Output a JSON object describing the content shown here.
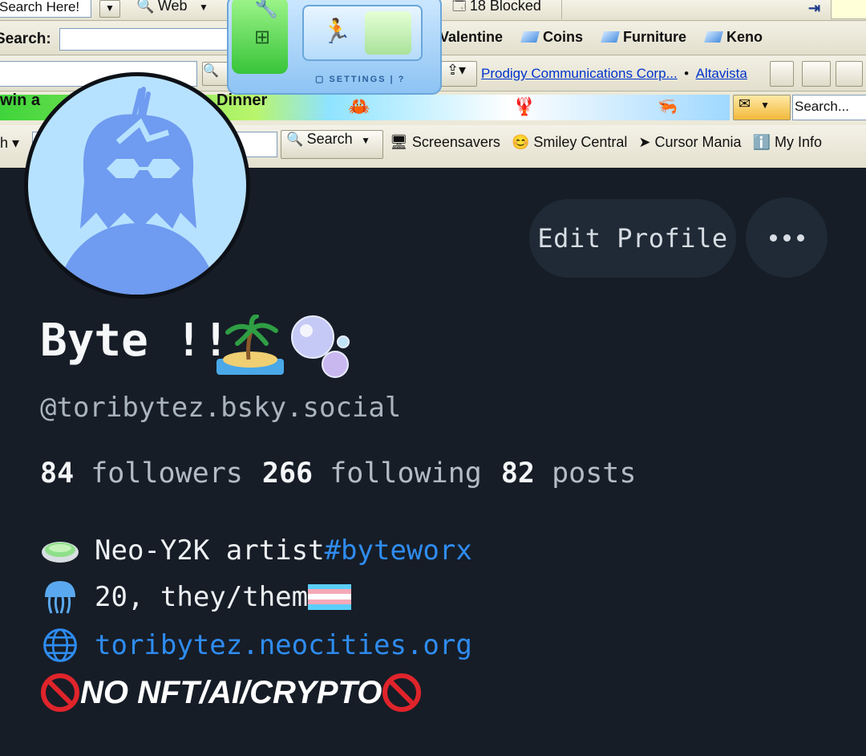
{
  "toolbar": {
    "search_here": "Search Here!",
    "web_label": "Web",
    "blocked_label": "18 Blocked",
    "search_label": "Search:",
    "links": [
      "Valentine",
      "Coins",
      "Furniture",
      "Keno"
    ],
    "settings_label": "SETTINGS",
    "settings_help": "?",
    "prodigy_link": "Prodigy Communications Corp...",
    "bullet": "•",
    "altavista_link": "Altavista",
    "ticker_left": "win a",
    "ticker_right": "Dinner",
    "mail_search_placeholder": "Search...",
    "search_button": "Search",
    "screensavers": "Screensavers",
    "smiley_central": "Smiley Central",
    "cursor_mania": "Cursor Mania",
    "my_info": "My Info",
    "small_left": "h"
  },
  "profile": {
    "display_name": "Byte !!",
    "handle": "@toribytez.bsky.social",
    "edit_button": "Edit Profile",
    "followers_count": "84",
    "followers_label": "followers",
    "following_count": "266",
    "following_label": "following",
    "posts_count": "82",
    "posts_label": "posts",
    "bio": {
      "line1_text": "Neo-Y2K artist ",
      "line1_tag": "#byteworx",
      "line2_text": "20, they/them",
      "line3_link": "toribytez.neocities.org",
      "line4_text": "NO NFT/AI/CRYPTO"
    }
  },
  "colors": {
    "background": "#161d27",
    "button_bg": "#1f2a36",
    "link": "#2f8cf0",
    "avatar_bg": "#b7e2ff",
    "avatar_fg": "#6f9bf0"
  },
  "icons": [
    "petri-dish-icon",
    "jellyfish-icon",
    "globe-icon",
    "no-entry-icon",
    "island-icon",
    "bubbles-icon",
    "trans-flag-icon"
  ]
}
